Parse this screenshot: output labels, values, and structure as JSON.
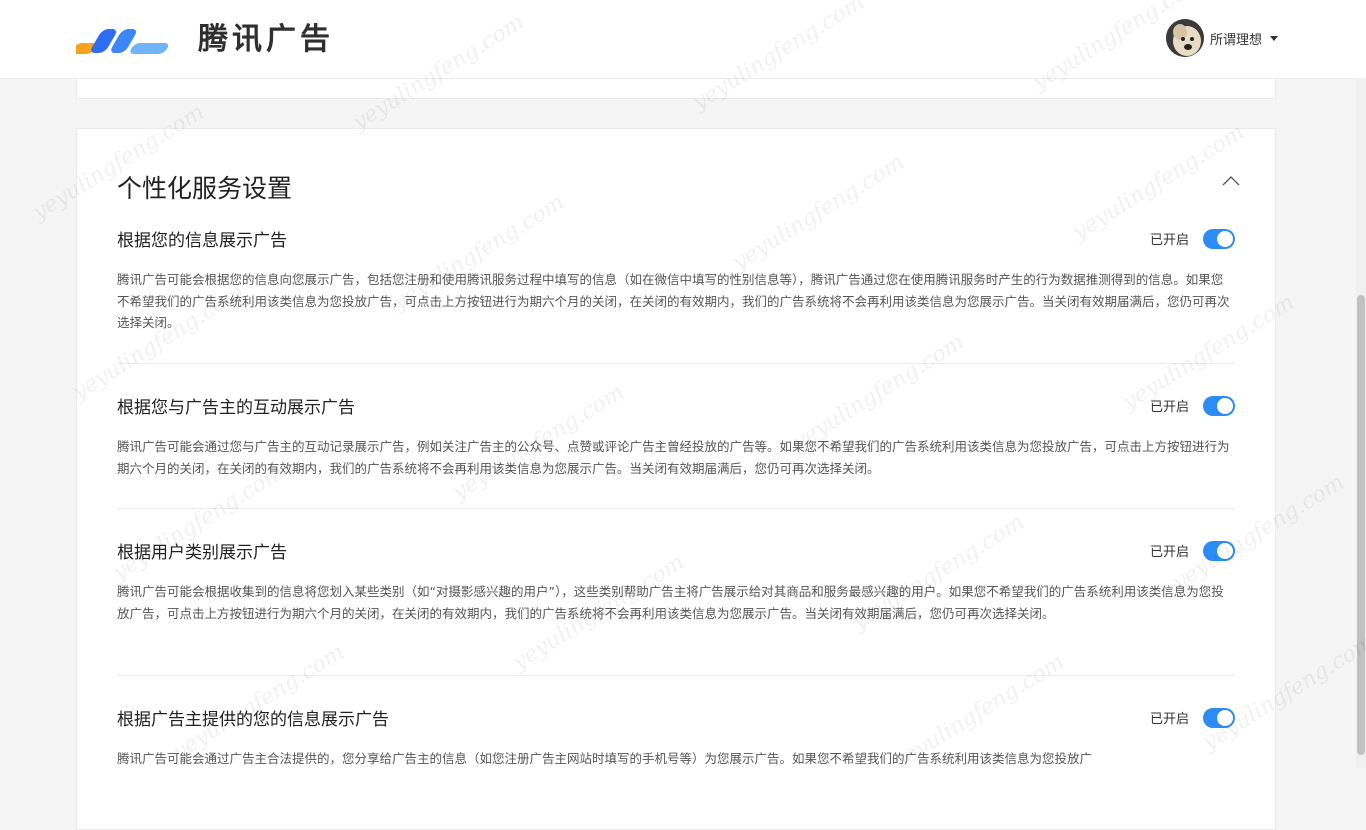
{
  "header": {
    "logo_text": "腾讯广告",
    "username": "所谓理想"
  },
  "card": {
    "title": "个性化服务设置",
    "sections": [
      {
        "title": "根据您的信息展示广告",
        "status": "已开启",
        "enabled": true,
        "desc": "腾讯广告可能会根据您的信息向您展示广告，包括您注册和使用腾讯服务过程中填写的信息（如在微信中填写的性别信息等），腾讯广告通过您在使用腾讯服务时产生的行为数据推测得到的信息。如果您不希望我们的广告系统利用该类信息为您投放广告，可点击上方按钮进行为期六个月的关闭，在关闭的有效期内，我们的广告系统将不会再利用该类信息为您展示广告。当关闭有效期届满后，您仍可再次选择关闭。"
      },
      {
        "title": "根据您与广告主的互动展示广告",
        "status": "已开启",
        "enabled": true,
        "desc": "腾讯广告可能会通过您与广告主的互动记录展示广告，例如关注广告主的公众号、点赞或评论广告主曾经投放的广告等。如果您不希望我们的广告系统利用该类信息为您投放广告，可点击上方按钮进行为期六个月的关闭，在关闭的有效期内，我们的广告系统将不会再利用该类信息为您展示广告。当关闭有效期届满后，您仍可再次选择关闭。"
      },
      {
        "title": "根据用户类别展示广告",
        "status": "已开启",
        "enabled": true,
        "desc": "腾讯广告可能会根据收集到的信息将您划入某些类别（如“对摄影感兴趣的用户”），这些类别帮助广告主将广告展示给对其商品和服务最感兴趣的用户。如果您不希望我们的广告系统利用该类信息为您投放广告，可点击上方按钮进行为期六个月的关闭，在关闭的有效期内，我们的广告系统将不会再利用该类信息为您展示广告。当关闭有效期届满后，您仍可再次选择关闭。"
      },
      {
        "title": "根据广告主提供的您的信息展示广告",
        "status": "已开启",
        "enabled": true,
        "desc": "腾讯广告可能会通过广告主合法提供的，您分享给广告主的信息（如您注册广告主网站时填写的手机号等）为您展示广告。如果您不希望我们的广告系统利用该类信息为您投放广"
      }
    ]
  },
  "watermark": "yeyulingfeng.com",
  "colors": {
    "accent": "#2b8cf6",
    "logo_orange": "#f7a21b",
    "logo_blue": "#2f6cf6",
    "logo_light": "#6fb3f8"
  },
  "icons": {
    "collapse": "chevron-up-icon",
    "dropdown": "caret-down-icon"
  }
}
